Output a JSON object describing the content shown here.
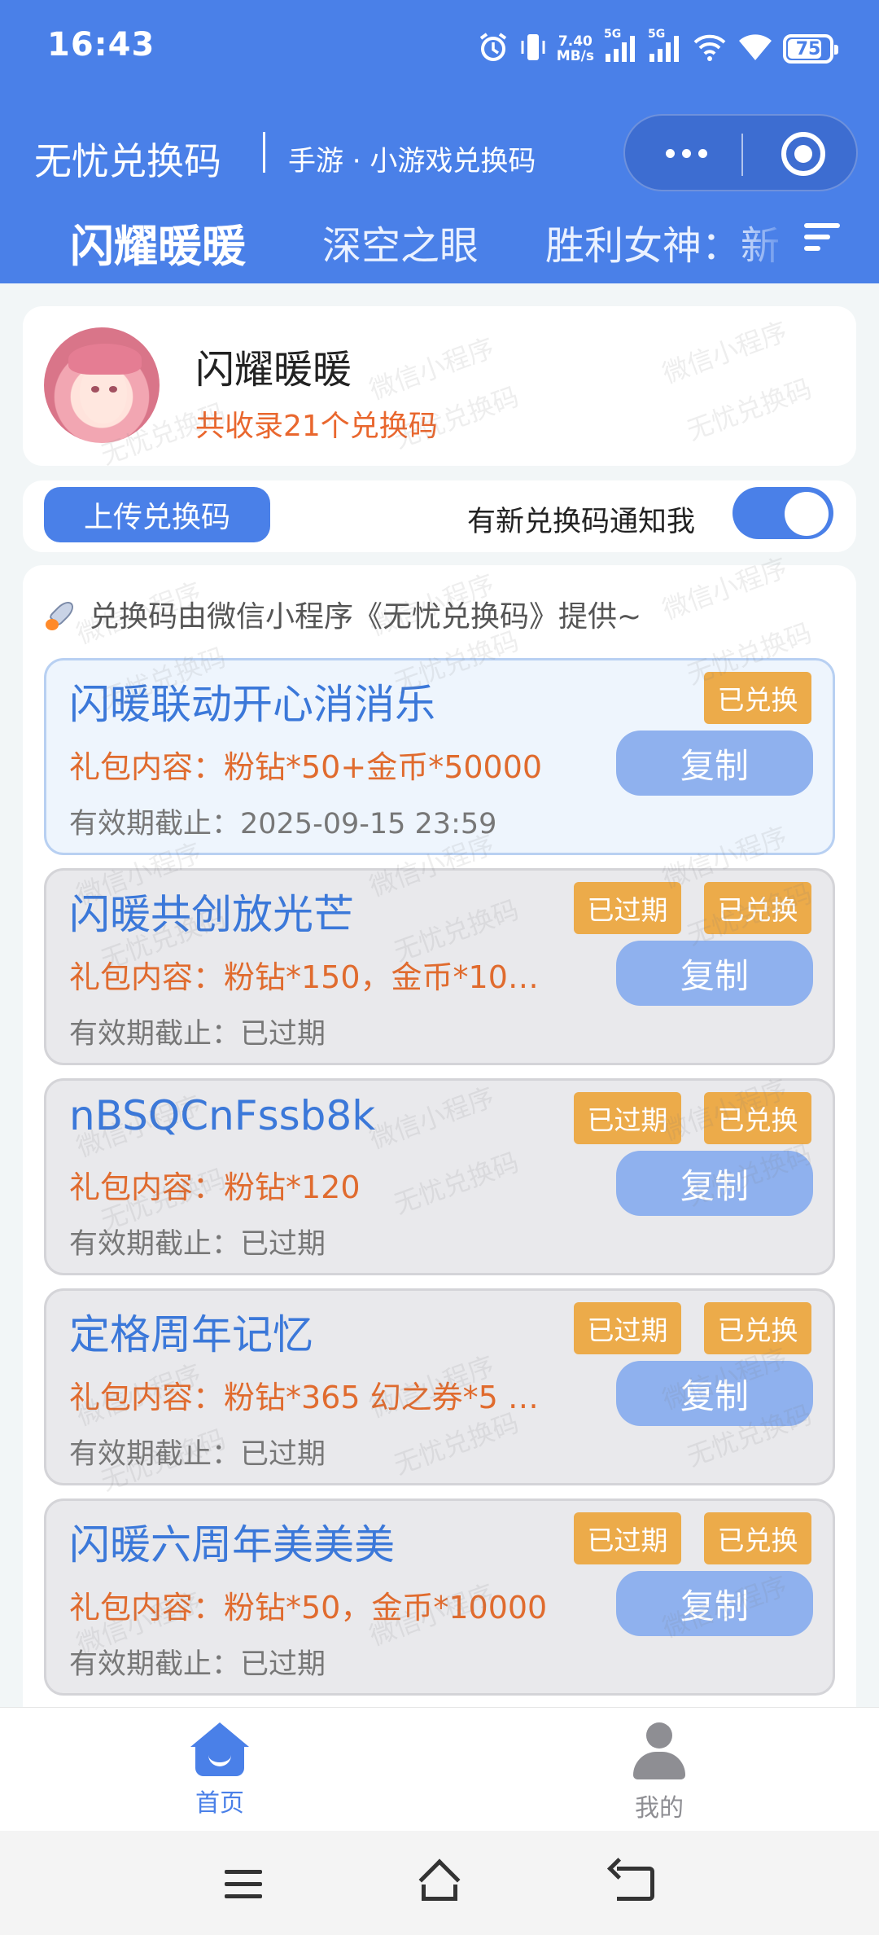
{
  "status": {
    "time": "16:43",
    "net_speed_value": "7.40",
    "net_speed_unit": "MB/s",
    "signal1": "5G",
    "signal2": "5G",
    "battery": "75"
  },
  "nav": {
    "title": "无忧兑换码",
    "subtitle": "手游 · 小游戏兑换码"
  },
  "tabs": [
    {
      "label": "闪耀暖暖",
      "active": true
    },
    {
      "label": "深空之眼",
      "active": false
    },
    {
      "label": "胜利女神：新",
      "active": false
    }
  ],
  "game": {
    "name": "闪耀暖暖",
    "count_text": "共收录21个兑换码"
  },
  "actions": {
    "upload_label": "上传兑换码",
    "notify_label": "有新兑换码通知我",
    "notify_on": true
  },
  "source_note": "兑换码由微信小程序《无忧兑换码》提供~",
  "codes": [
    {
      "title": "闪暖联动开心消消乐",
      "content": "礼包内容：粉钻*50+金币*50000",
      "expire": "有效期截止：2025-09-15 23:59",
      "expired_badge": "",
      "redeemed_badge": "已兑换",
      "copy": "复制"
    },
    {
      "title": "闪暖共创放光芒",
      "content": "礼包内容：粉钻*150，金币*10…",
      "expire": "有效期截止：已过期",
      "expired_badge": "已过期",
      "redeemed_badge": "已兑换",
      "copy": "复制"
    },
    {
      "title": "nBSQCnFssb8k",
      "content": "礼包内容：粉钻*120",
      "expire": "有效期截止：已过期",
      "expired_badge": "已过期",
      "redeemed_badge": "已兑换",
      "copy": "复制"
    },
    {
      "title": "定格周年记忆",
      "content": "礼包内容：粉钻*365 幻之券*5 …",
      "expire": "有效期截止：已过期",
      "expired_badge": "已过期",
      "redeemed_badge": "已兑换",
      "copy": "复制"
    },
    {
      "title": "闪暖六周年美美美",
      "content": "礼包内容：粉钻*50，金币*10000",
      "expire": "有效期截止：已过期",
      "expired_badge": "已过期",
      "redeemed_badge": "已兑换",
      "copy": "复制"
    }
  ],
  "watermark": [
    "微信小程序",
    "无忧兑换码"
  ],
  "tabbar": {
    "home": "首页",
    "mine": "我的"
  },
  "colors": {
    "primary": "#4a80e8",
    "accent_orange": "#e06b2e",
    "badge": "#ecab4a",
    "copy_button": "#8fb1ee"
  }
}
